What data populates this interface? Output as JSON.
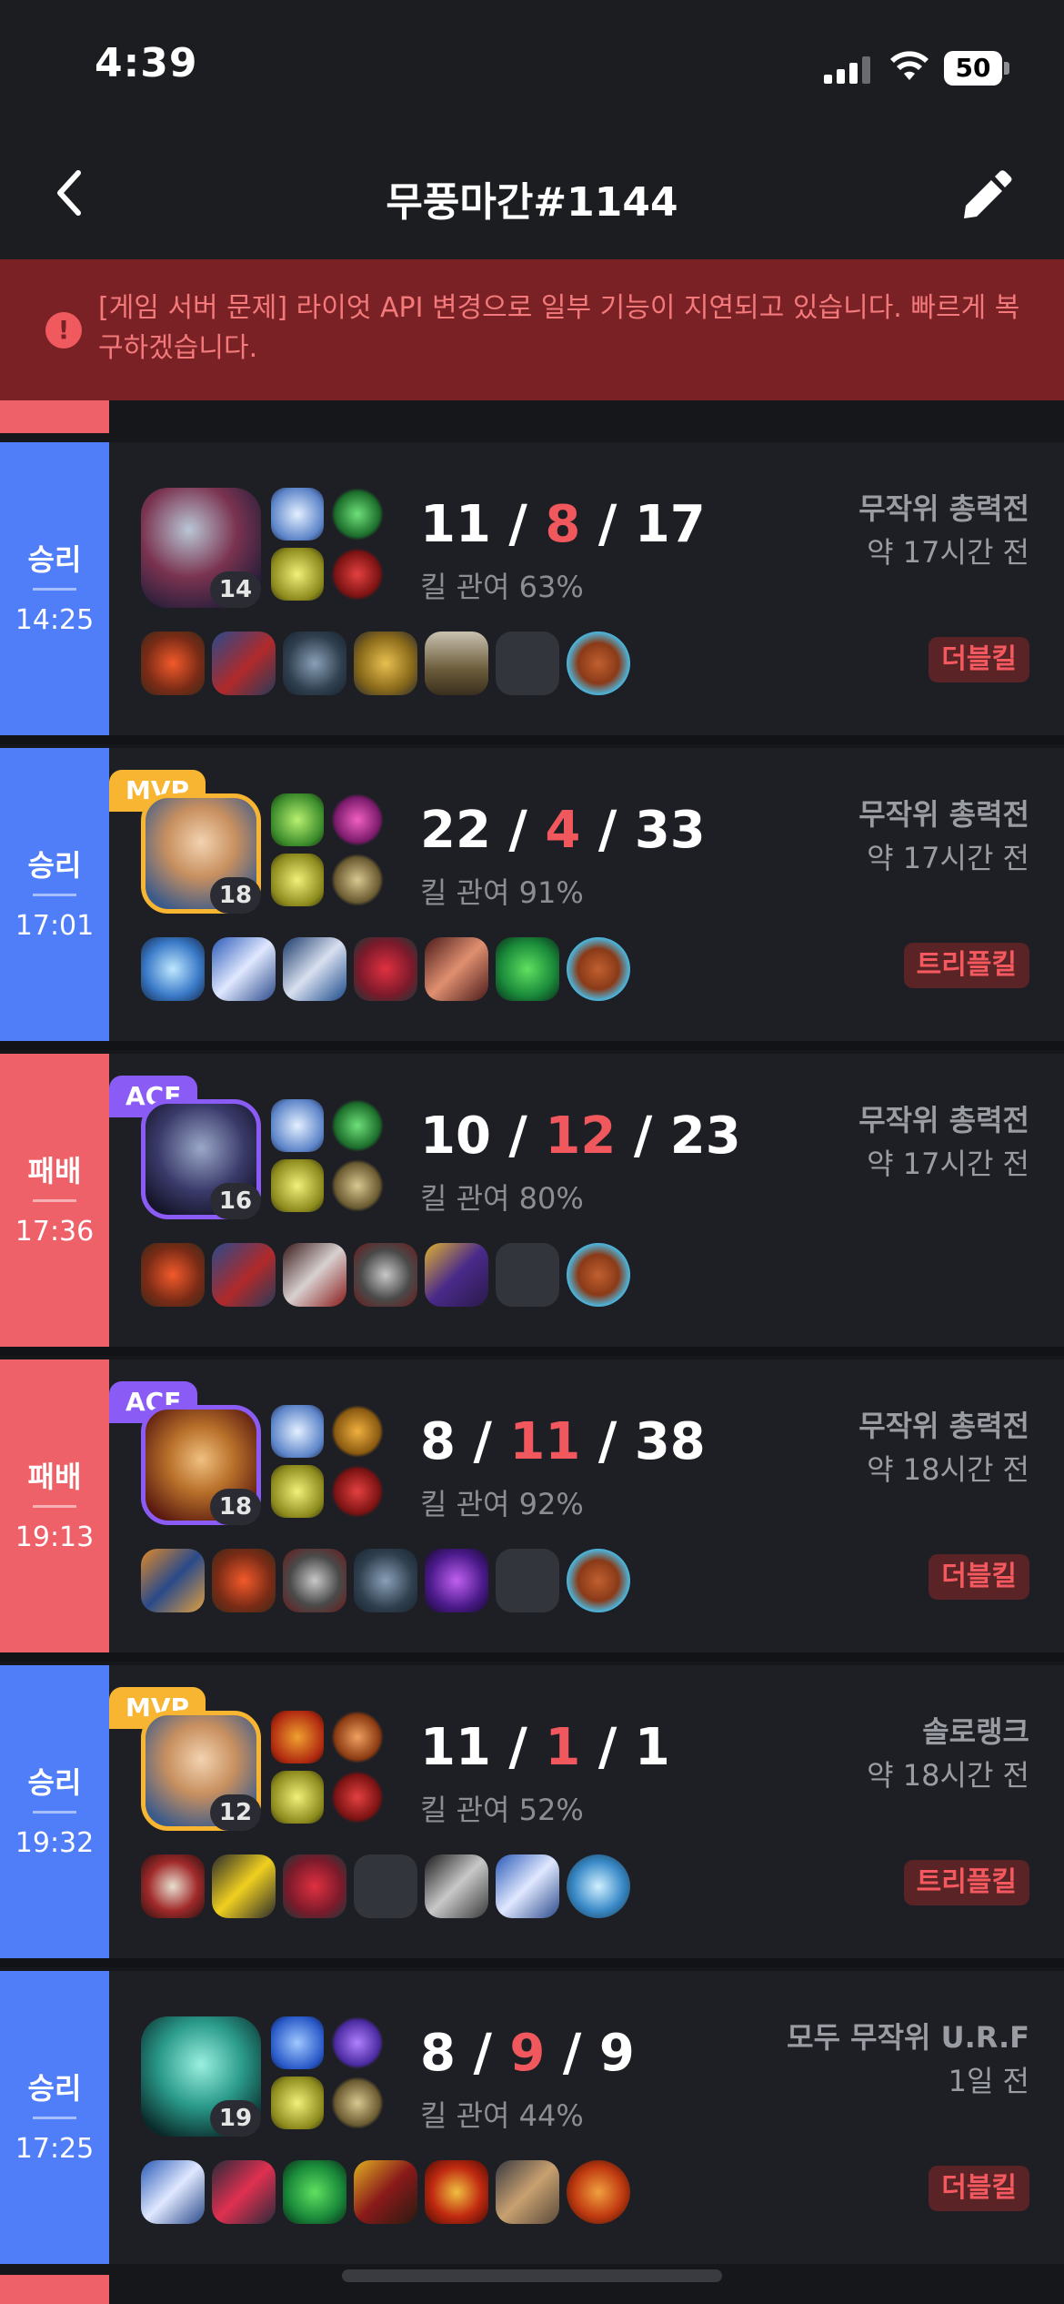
{
  "status": {
    "time": "4:39",
    "battery": "50"
  },
  "header": {
    "title": "무풍마간#1144"
  },
  "banner": {
    "message": "[게임 서버 문제] 라이엇 API 변경으로 일부 기능이 지연되고 있습니다. 빠르게 복구하겠습니다."
  },
  "matches": [
    {
      "result": "승리",
      "duration": "14:25",
      "level": "14",
      "badge": "",
      "kills": "11",
      "deaths": "8",
      "assists": "17",
      "kill_participation": "킬 관여 63%",
      "mode": "무작위 총력전",
      "ago": "약 17시간 전",
      "multikill": "더블킬"
    },
    {
      "result": "승리",
      "duration": "17:01",
      "level": "18",
      "badge": "MVP",
      "kills": "22",
      "deaths": "4",
      "assists": "33",
      "kill_participation": "킬 관여 91%",
      "mode": "무작위 총력전",
      "ago": "약 17시간 전",
      "multikill": "트리플킬"
    },
    {
      "result": "패배",
      "duration": "17:36",
      "level": "16",
      "badge": "ACE",
      "kills": "10",
      "deaths": "12",
      "assists": "23",
      "kill_participation": "킬 관여 80%",
      "mode": "무작위 총력전",
      "ago": "약 17시간 전",
      "multikill": ""
    },
    {
      "result": "패배",
      "duration": "19:13",
      "level": "18",
      "badge": "ACE",
      "kills": "8",
      "deaths": "11",
      "assists": "38",
      "kill_participation": "킬 관여 92%",
      "mode": "무작위 총력전",
      "ago": "약 18시간 전",
      "multikill": "더블킬"
    },
    {
      "result": "승리",
      "duration": "19:32",
      "level": "12",
      "badge": "MVP",
      "kills": "11",
      "deaths": "1",
      "assists": "1",
      "kill_participation": "킬 관여 52%",
      "mode": "솔로랭크",
      "ago": "약 18시간 전",
      "multikill": "트리플킬"
    },
    {
      "result": "승리",
      "duration": "17:25",
      "level": "19",
      "badge": "",
      "kills": "8",
      "deaths": "9",
      "assists": "9",
      "kill_participation": "킬 관여 44%",
      "mode": "모두 무작위 U.R.F",
      "ago": "1일 전",
      "multikill": "더블킬"
    }
  ],
  "colors": {
    "win": "#4f7ef8",
    "lose": "#ee6168",
    "mvp": "#f7b531",
    "ace": "#8a5cf5",
    "death": "#f0585d",
    "banner": "#7a2125"
  },
  "icons": {
    "back": "chevron-left-icon",
    "edit": "pencil-icon",
    "warning": "exclamation-icon"
  }
}
